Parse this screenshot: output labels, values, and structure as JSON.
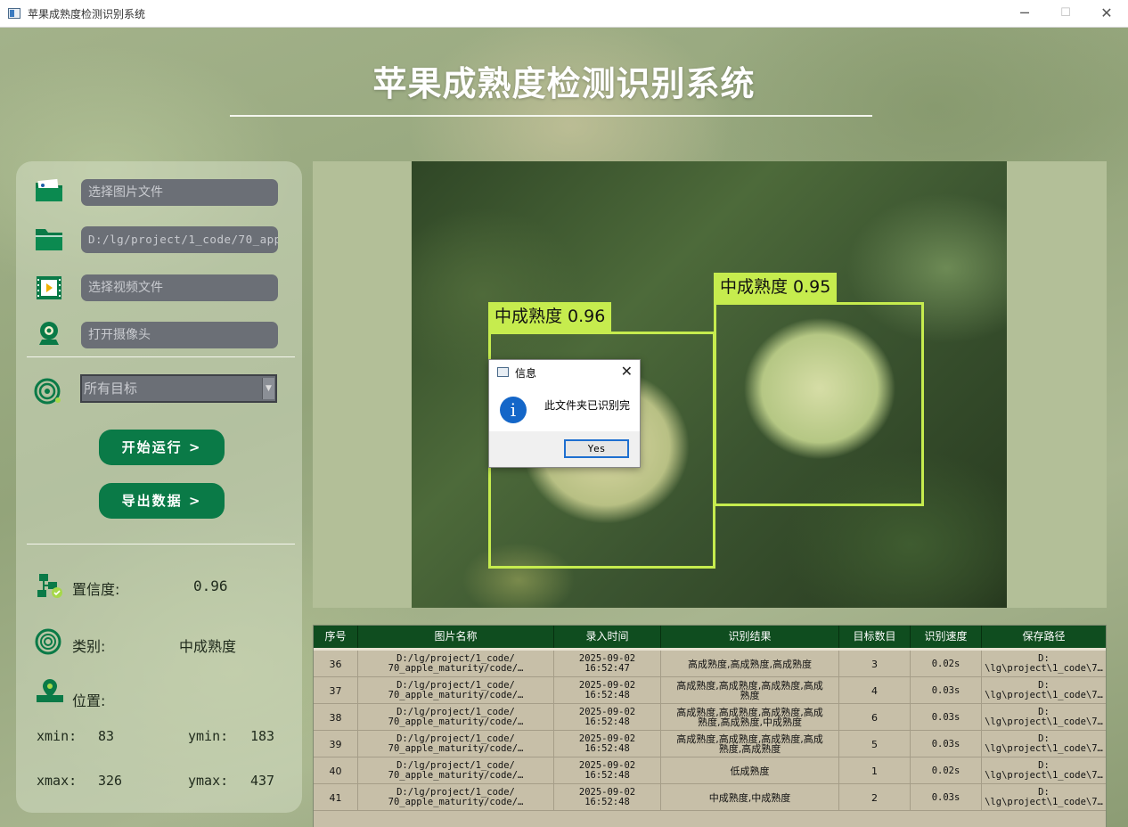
{
  "window": {
    "title": "苹果成熟度检测识别系统",
    "min_glyph": "─",
    "max_glyph": "☐",
    "close_glyph": "✕"
  },
  "header": {
    "title": "苹果成熟度检测识别系统"
  },
  "sidebar": {
    "image_placeholder": "选择图片文件",
    "folder_value": "D:/lg/project/1_code/70_app",
    "video_placeholder": "选择视频文件",
    "camera_placeholder": "打开摄像头",
    "target_select": "所有目标",
    "start_button": "开始运行 >",
    "export_button": "导出数据 >",
    "confidence_label": "置信度:",
    "confidence_value": "0.96",
    "class_label": "类别:",
    "class_value": "中成熟度",
    "position_label": "位置:",
    "xmin_label": "xmin:",
    "xmin_value": "83",
    "ymin_label": "ymin:",
    "ymin_value": "183",
    "xmax_label": "xmax:",
    "xmax_value": "326",
    "ymax_label": "ymax:",
    "ymax_value": "437"
  },
  "viewer": {
    "detections": [
      {
        "label": "中成熟度 0.96"
      },
      {
        "label": "中成熟度 0.95"
      }
    ]
  },
  "dialog": {
    "title": "信息",
    "message": "此文件夹已识别完",
    "yes_button": "Yes",
    "close_glyph": "✕",
    "info_glyph": "i"
  },
  "table": {
    "headers": [
      "序号",
      "图片名称",
      "录入时间",
      "识别结果",
      "目标数目",
      "识别速度",
      "保存路径"
    ],
    "rows": [
      {
        "id": "36",
        "name": "D:/lg/project/1_code/\n70_apple_maturity/code/…",
        "time": "2025-09-02\n16:52:47",
        "result": "高成熟度,高成熟度,高成熟度",
        "count": "3",
        "speed": "0.02s",
        "path": "D:\n\\lg\\project\\1_code\\7…"
      },
      {
        "id": "37",
        "name": "D:/lg/project/1_code/\n70_apple_maturity/code/…",
        "time": "2025-09-02\n16:52:48",
        "result": "高成熟度,高成熟度,高成熟度,高成\n熟度",
        "count": "4",
        "speed": "0.03s",
        "path": "D:\n\\lg\\project\\1_code\\7…"
      },
      {
        "id": "38",
        "name": "D:/lg/project/1_code/\n70_apple_maturity/code/…",
        "time": "2025-09-02\n16:52:48",
        "result": "高成熟度,高成熟度,高成熟度,高成\n熟度,高成熟度,中成熟度",
        "count": "6",
        "speed": "0.03s",
        "path": "D:\n\\lg\\project\\1_code\\7…"
      },
      {
        "id": "39",
        "name": "D:/lg/project/1_code/\n70_apple_maturity/code/…",
        "time": "2025-09-02\n16:52:48",
        "result": "高成熟度,高成熟度,高成熟度,高成\n熟度,高成熟度",
        "count": "5",
        "speed": "0.03s",
        "path": "D:\n\\lg\\project\\1_code\\7…"
      },
      {
        "id": "40",
        "name": "D:/lg/project/1_code/\n70_apple_maturity/code/…",
        "time": "2025-09-02\n16:52:48",
        "result": "低成熟度",
        "count": "1",
        "speed": "0.02s",
        "path": "D:\n\\lg\\project\\1_code\\7…"
      },
      {
        "id": "41",
        "name": "D:/lg/project/1_code/\n70_apple_maturity/code/…",
        "time": "2025-09-02\n16:52:48",
        "result": "中成熟度,中成熟度",
        "count": "2",
        "speed": "0.03s",
        "path": "D:\n\\lg\\project\\1_code\\7…"
      }
    ]
  },
  "colors": {
    "accent": "#0a7a47",
    "bbox": "#c6ec4e",
    "table_header": "#0f4d1f"
  }
}
